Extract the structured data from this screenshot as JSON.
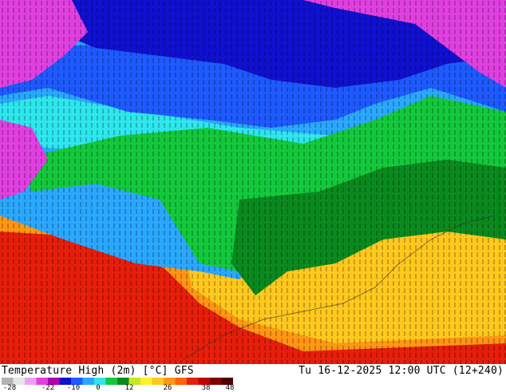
{
  "map": {
    "region": "Asia",
    "variable": "temperature-high-2m"
  },
  "footer": {
    "title": "Temperature High (2m) [°C] GFS",
    "datetime": "Tu 16-12-2025 12:00 UTC (12+240)"
  },
  "legend": {
    "ticks": [
      "-28",
      "-22",
      "-10",
      "0",
      "12",
      "26",
      "38",
      "48"
    ],
    "palette": [
      "#b3b3b3",
      "#e6e6e6",
      "#f0a0f0",
      "#e040e0",
      "#b000b0",
      "#1010d0",
      "#1e5aff",
      "#2aa8ff",
      "#2ee6ee",
      "#14c83c",
      "#0a8a1e",
      "#c8e61e",
      "#fff028",
      "#ffc81e",
      "#ff9614",
      "#ff640a",
      "#e61e0a",
      "#c00000",
      "#800000",
      "#500000"
    ]
  },
  "colors": {
    "deep-cold": "#1010d0",
    "cold": "#1e5aff",
    "cool": "#2aa8ff",
    "cyan": "#2ee6ee",
    "green": "#14c83c",
    "yellow": "#fff028",
    "orange": "#ff9614",
    "red": "#e61e0a",
    "magenta": "#e040e0"
  }
}
